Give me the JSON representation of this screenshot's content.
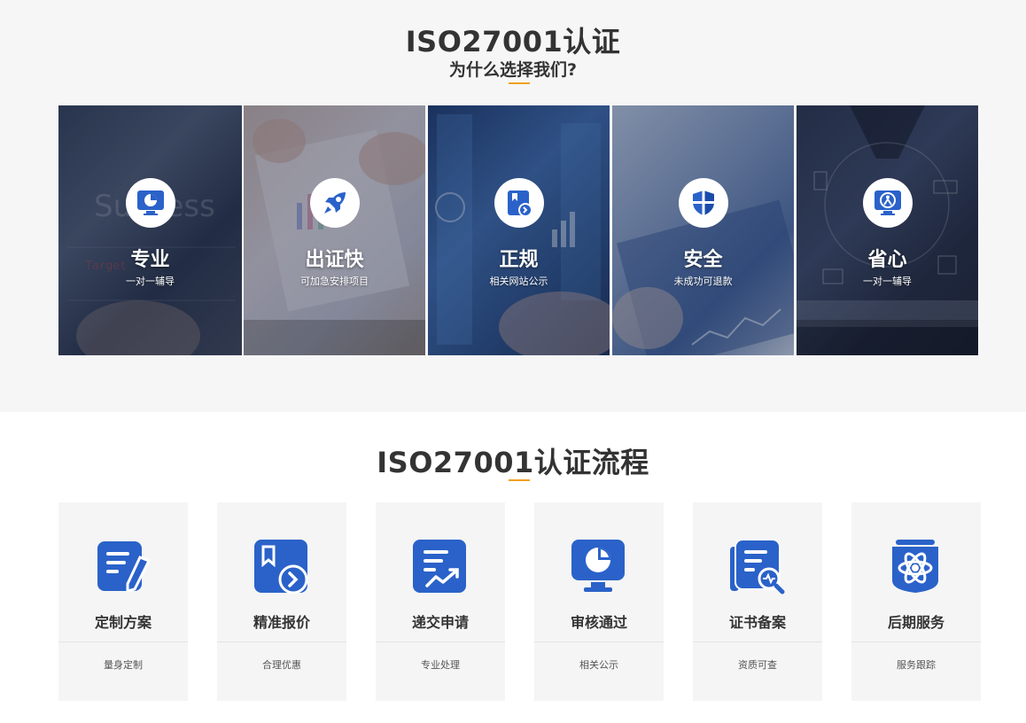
{
  "why_section": {
    "title": "ISO27001认证",
    "subtitle": "为什么选择我们?",
    "cards": [
      {
        "name": "专业",
        "desc": "一对一辅导",
        "icon": "monitor-pie-icon"
      },
      {
        "name": "出证快",
        "desc": "可加急安排项目",
        "icon": "rocket-icon"
      },
      {
        "name": "正规",
        "desc": "相关网站公示",
        "icon": "bookmark-doc-icon"
      },
      {
        "name": "安全",
        "desc": "未成功可退款",
        "icon": "shield-icon"
      },
      {
        "name": "省心",
        "desc": "一对一辅导",
        "icon": "person-monitor-icon"
      }
    ]
  },
  "flow_section": {
    "title": "ISO27001认证流程",
    "steps": [
      {
        "name": "定制方案",
        "desc": "量身定制",
        "icon": "edit-doc-icon"
      },
      {
        "name": "精准报价",
        "desc": "合理优惠",
        "icon": "bookmark-arrow-icon"
      },
      {
        "name": "递交申请",
        "desc": "专业处理",
        "icon": "chart-doc-icon"
      },
      {
        "name": "审核通过",
        "desc": "相关公示",
        "icon": "monitor-pie-icon"
      },
      {
        "name": "证书备案",
        "desc": "资质可查",
        "icon": "doc-search-icon"
      },
      {
        "name": "后期服务",
        "desc": "服务跟踪",
        "icon": "atom-icon"
      }
    ]
  },
  "colors": {
    "accent": "#f0a020",
    "icon_blue": "#2a62c9",
    "section_bg": "#f6f6f7",
    "step_bg": "#f5f5f5"
  }
}
